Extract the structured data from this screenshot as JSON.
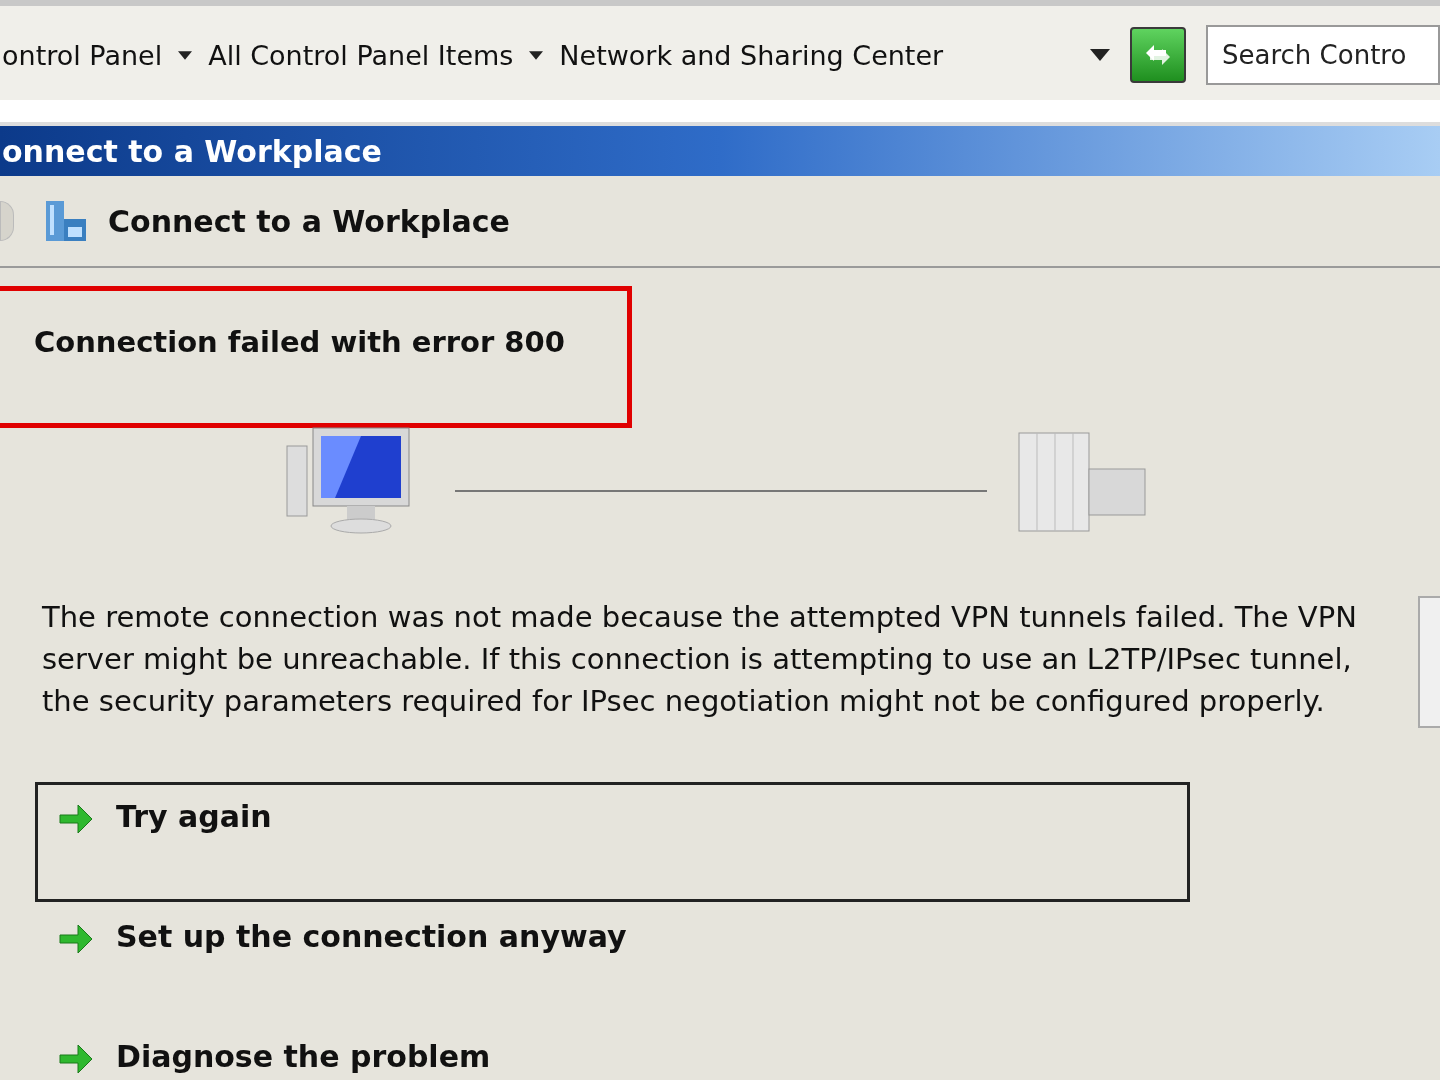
{
  "address_bar": {
    "breadcrumbs": [
      "ontrol Panel",
      "All Control Panel Items",
      "Network and Sharing Center"
    ]
  },
  "search": {
    "placeholder": "Search Contro"
  },
  "window": {
    "title": "onnect to a Workplace"
  },
  "wizard": {
    "heading": "Connect to a Workplace",
    "error_title": "Connection failed with error 800",
    "message": "The remote connection was not made because the attempted VPN tunnels failed. The VPN server might be unreachable. If this connection is attempting to use an L2TP/IPsec tunnel, the security parameters required for IPsec negotiation might not be configured properly.",
    "options": [
      {
        "label": "Try again",
        "selected": true
      },
      {
        "label": "Set up the connection anyway",
        "selected": false
      },
      {
        "label": "Diagnose the problem",
        "selected": false
      }
    ]
  }
}
